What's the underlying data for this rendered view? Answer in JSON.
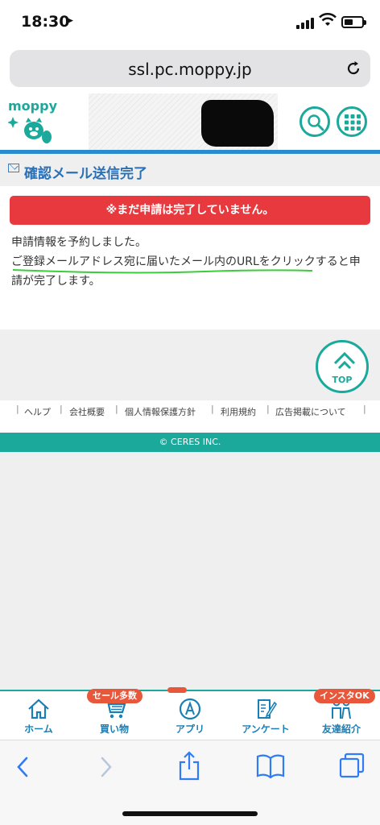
{
  "status": {
    "time": "18:30"
  },
  "browser": {
    "url": "ssl.pc.moppy.jp"
  },
  "site": {
    "logo_text": "moppy"
  },
  "page": {
    "title": "確認メール送信完了",
    "alert": "※まだ申請は完了していません。",
    "message_line1": "申請情報を予約しました。",
    "message_line2": "ご登録メールアドレス宛に届いたメール内のURLをクリックすると申請が完了します。"
  },
  "top_button": {
    "label": "TOP"
  },
  "footer": {
    "links": [
      "ヘルプ",
      "会社概要",
      "個人情報保護方針",
      "利用規約",
      "広告掲載について"
    ],
    "copyright": "© CERES INC."
  },
  "app_nav": {
    "items": [
      {
        "label": "ホーム",
        "icon": "home-icon"
      },
      {
        "label": "買い物",
        "icon": "cart-icon",
        "badge": "セール多数"
      },
      {
        "label": "アプリ",
        "icon": "app-a-icon"
      },
      {
        "label": "アンケート",
        "icon": "survey-icon"
      },
      {
        "label": "友達紹介",
        "icon": "friends-icon",
        "badge": "インスタOK"
      }
    ]
  },
  "colors": {
    "accent": "#1aa99b",
    "alert": "#e8393f",
    "title": "#2b70b5",
    "badge": "#e8573a"
  }
}
